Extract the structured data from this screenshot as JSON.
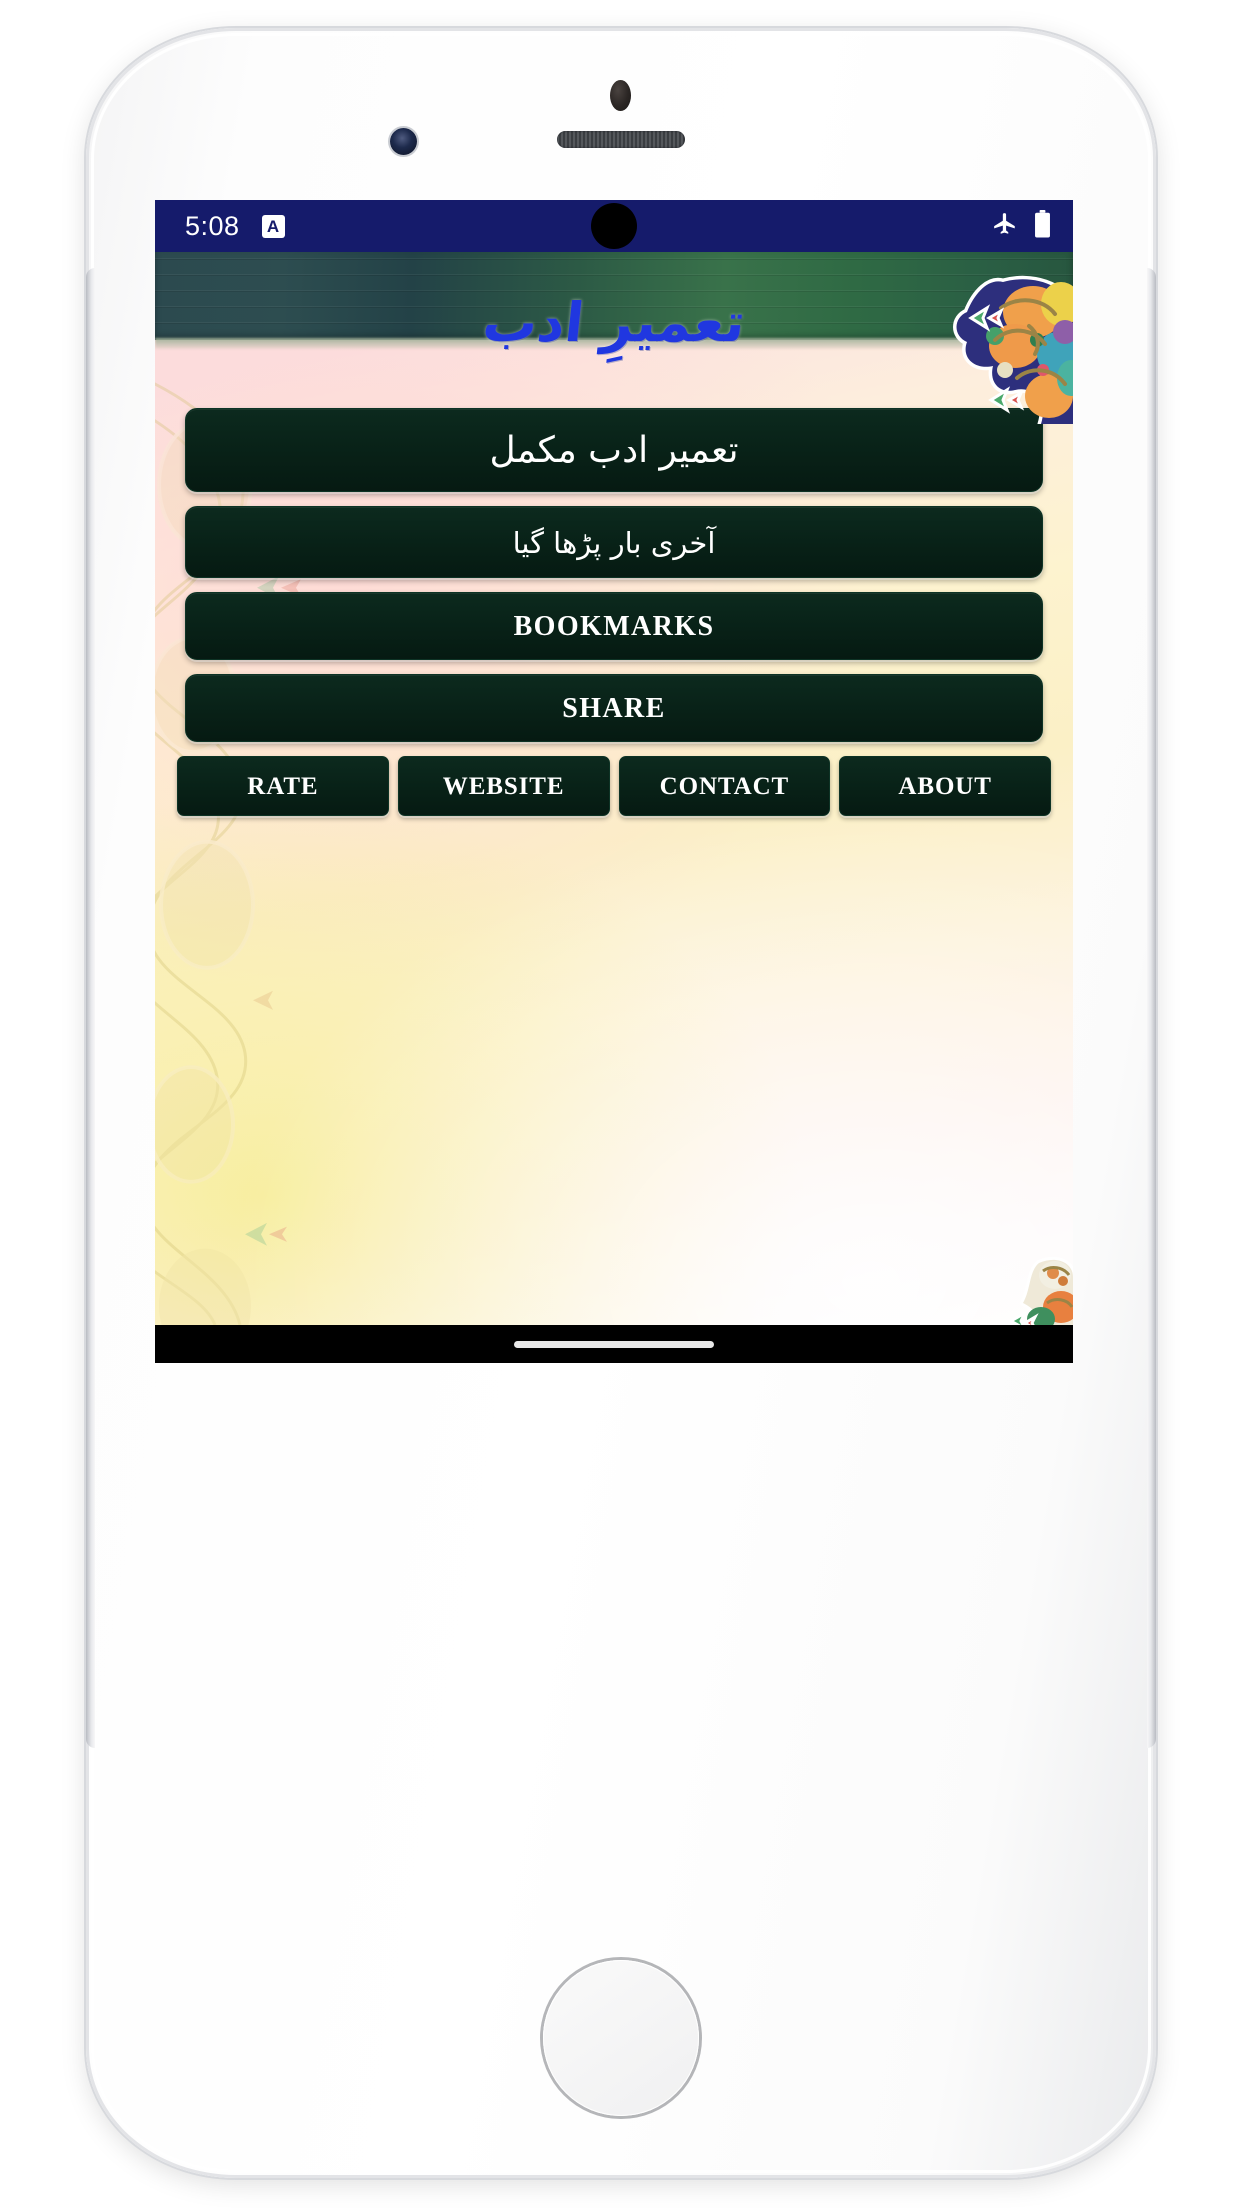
{
  "status_bar": {
    "time": "5:08",
    "notification_badge": "A",
    "icons": [
      "airplane-mode-icon",
      "battery-icon"
    ],
    "background_color": "#151b6b"
  },
  "app": {
    "logo_text": "تعمیرِ ادب",
    "logo_color": "#2037e0",
    "banner_colors": [
      "#2c4a4f",
      "#39724a"
    ],
    "button_color": "#082117",
    "ornaments": [
      "ornament-top-right",
      "ornament-bottom-right",
      "left-floral-border"
    ]
  },
  "menu": {
    "items": [
      {
        "id": "full-book",
        "label": "تعمیر ادب مکمل",
        "script": "urdu"
      },
      {
        "id": "last-read",
        "label": "آخری بار پڑھا گیا",
        "script": "urdu"
      },
      {
        "id": "bookmarks",
        "label": "BOOKMARKS",
        "script": "latin"
      },
      {
        "id": "share",
        "label": "SHARE",
        "script": "latin"
      }
    ]
  },
  "quick_actions": {
    "items": [
      {
        "id": "rate",
        "label": "RATE"
      },
      {
        "id": "website",
        "label": "WEBSITE"
      },
      {
        "id": "contact",
        "label": "CONTACT"
      },
      {
        "id": "about",
        "label": "ABOUT"
      }
    ]
  },
  "nav_bar": {
    "gesture_pill": "home-indicator"
  }
}
